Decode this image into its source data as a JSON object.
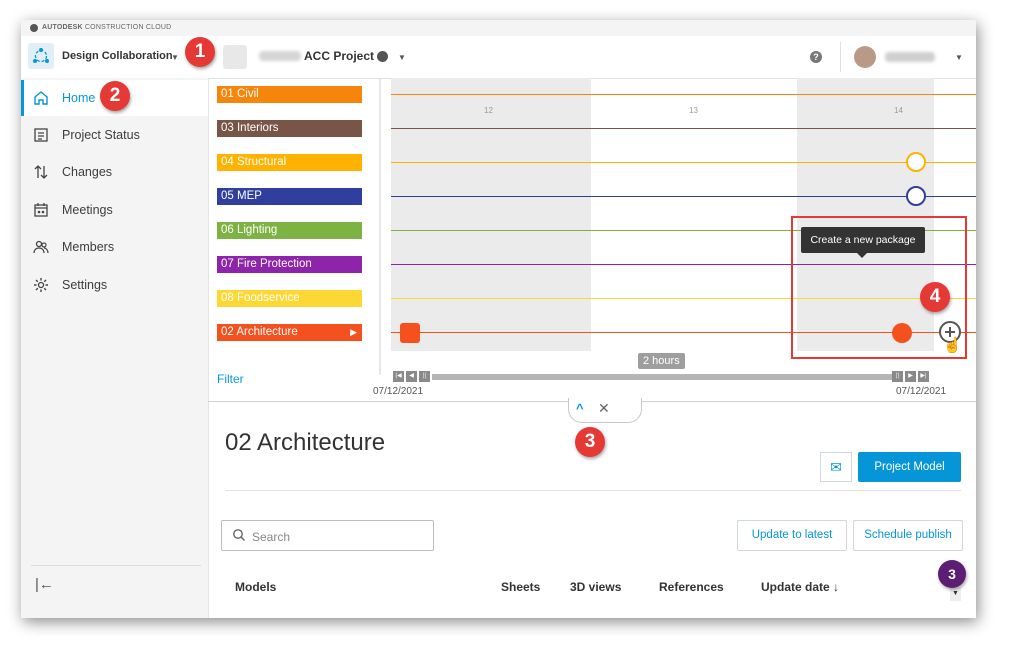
{
  "brand": {
    "text_bold": "AUTODESK",
    "text": "CONSTRUCTION CLOUD"
  },
  "header": {
    "app_name": "Design Collaboration",
    "project_name": "ACC Project"
  },
  "sidebar": {
    "items": [
      {
        "label": "Home",
        "icon": "home-icon",
        "active": true
      },
      {
        "label": "Project Status",
        "icon": "status-icon"
      },
      {
        "label": "Changes",
        "icon": "changes-icon"
      },
      {
        "label": "Meetings",
        "icon": "meetings-icon"
      },
      {
        "label": "Members",
        "icon": "members-icon"
      },
      {
        "label": "Settings",
        "icon": "gear-icon"
      }
    ]
  },
  "teams": [
    {
      "label": "01 Civil",
      "color": "#f5850b"
    },
    {
      "label": "03 Interiors",
      "color": "#795548"
    },
    {
      "label": "04 Structural",
      "color": "#ffb300"
    },
    {
      "label": "05 MEP",
      "color": "#303f9f"
    },
    {
      "label": "06 Lighting",
      "color": "#7cb342"
    },
    {
      "label": "07 Fire Protection",
      "color": "#8e24aa"
    },
    {
      "label": "08 Foodservice",
      "color": "#fdd835"
    },
    {
      "label": "02 Architecture",
      "color": "#f4511e",
      "selected": true
    }
  ],
  "filter_label": "Filter",
  "timeline": {
    "ticks": [
      "12",
      "13",
      "14"
    ],
    "tooltip": "Create a new package",
    "scrub_label": "2 hours",
    "start_date": "07/12/2021",
    "end_date": "07/12/2021"
  },
  "detail": {
    "title": "02 Architecture",
    "primary_button": "Project Model",
    "search_placeholder": "Search",
    "update_button": "Update to latest",
    "schedule_button": "Schedule publish",
    "columns": [
      "Models",
      "Sheets",
      "3D views",
      "References",
      "Update date ↓"
    ]
  },
  "annotations": [
    "1",
    "2",
    "3",
    "4",
    "3"
  ],
  "colors": {
    "accent": "#0696d7",
    "annotation": "#e53935"
  }
}
